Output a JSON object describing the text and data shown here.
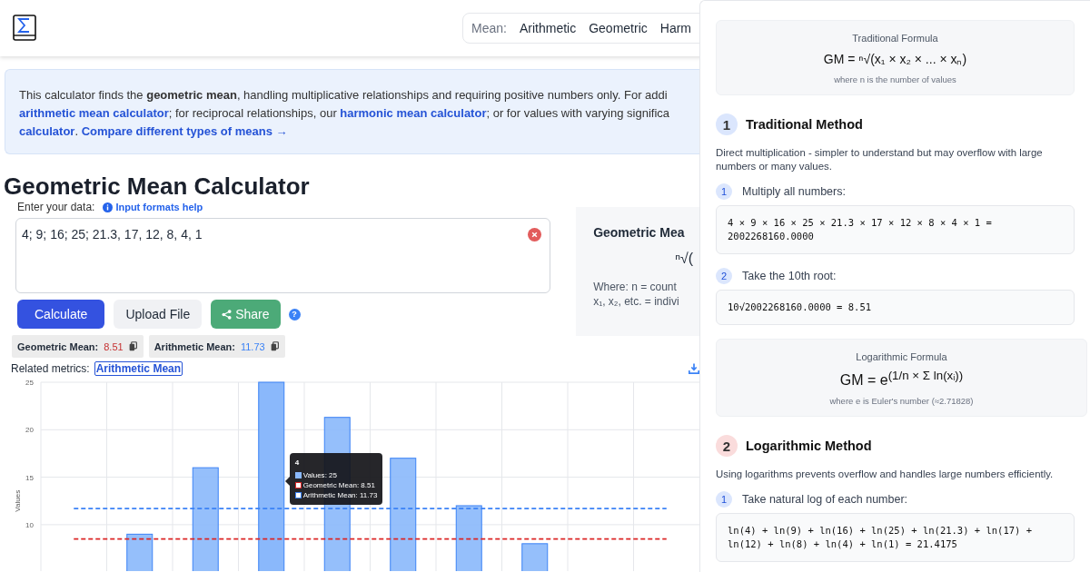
{
  "header": {
    "nav_label": "Mean:",
    "nav_items": [
      "Arithmetic",
      "Geometric",
      "Harm"
    ]
  },
  "intro": [
    {
      "kind": "text",
      "text": "This calculator finds the "
    },
    {
      "kind": "bold",
      "text": "geometric mean"
    },
    {
      "kind": "text",
      "text": ", handling multiplicative relationships and requiring positive numbers only. For addi"
    },
    {
      "kind": "break"
    },
    {
      "kind": "link",
      "text": "arithmetic mean calculator"
    },
    {
      "kind": "text",
      "text": "; for reciprocal relationships, our "
    },
    {
      "kind": "link",
      "text": "harmonic mean calculator"
    },
    {
      "kind": "text",
      "text": "; or for values with varying significa"
    },
    {
      "kind": "break"
    },
    {
      "kind": "link",
      "text": "calculator"
    },
    {
      "kind": "text",
      "text": ". "
    },
    {
      "kind": "link",
      "text": "Compare different types of means →"
    }
  ],
  "title": "Geometric Mean Calculator",
  "input": {
    "label": "Enter your data:",
    "help_link": "Input formats help",
    "value": "4; 9; 16; 25; 21.3, 17, 12, 8, 4, 1"
  },
  "buttons": [
    {
      "label": "Calculate",
      "kind": "primary"
    },
    {
      "label": "Upload File",
      "kind": "secondary"
    },
    {
      "label": "Share",
      "kind": "share"
    }
  ],
  "help_icon": "?",
  "results": [
    {
      "label": "Geometric Mean:",
      "value": "8.51",
      "color": "#c53030"
    },
    {
      "label": "Arithmetic Mean:",
      "value": "11.73",
      "color": "#3b82f6"
    }
  ],
  "related": {
    "label": "Related metrics:",
    "link": "Arithmetic Mean"
  },
  "chart": {
    "chart_data": {
      "type": "bar",
      "ylabel": "Values",
      "ylim": [
        5,
        25
      ],
      "yticks": [
        10,
        15,
        20,
        25
      ],
      "grid": true,
      "legend": "center",
      "series": [
        {
          "name": "Values",
          "type": "bar",
          "color": "#8ab8fb",
          "values": [
            null,
            9,
            16,
            25,
            21.3,
            17,
            12,
            8,
            null,
            null
          ]
        },
        {
          "name": "Geometric Mean",
          "type": "line",
          "line_style": "dashed",
          "color": "#dc2626",
          "values": [
            8.5,
            8.5,
            8.5,
            8.5,
            8.5,
            8.5,
            8.5,
            8.5,
            8.5,
            8.5
          ]
        },
        {
          "name": "Arithmetic Mean",
          "type": "line",
          "line_style": "dashed",
          "color": "#3b82f6",
          "values": [
            11.7,
            11.7,
            11.7,
            11.7,
            11.7,
            11.7,
            11.7,
            11.7,
            11.7,
            11.7
          ]
        }
      ]
    },
    "tooltip": {
      "title": "4",
      "values": [
        ": 25",
        ": 8.51",
        ": 11.73"
      ]
    }
  },
  "formula_card": {
    "title": "Geometric Mea",
    "formula": "ⁿ√(",
    "note_lines": [
      "Where: n = count",
      "x₁, x₂, etc. = indivi"
    ]
  },
  "panel": [
    {
      "kind": "formula",
      "title": "Traditional Formula",
      "formula": "GM = ⁿ√(x₁ × x₂ × ... × xₙ)",
      "note": "where n is the number of values"
    },
    {
      "kind": "method",
      "number": "1",
      "color": "#dbe6fd",
      "title": "Traditional Method",
      "description": "Direct multiplication - simpler to understand but may overflow with large numbers or many values.",
      "steps": [
        {
          "number": "1",
          "title": "Multiply all numbers:",
          "code": "4 × 9 × 16 × 25 × 21.3 × 17 × 12 × 8 × 4 × 1 = 2002268160.0000"
        },
        {
          "number": "2",
          "title": "Take the 10th root:",
          "code": "10√2002268160.0000 = 8.51"
        }
      ]
    },
    {
      "kind": "formula",
      "title": "Logarithmic Formula",
      "formula": "GM = e$^{(1/n × Σ ln(xᵢ))}$",
      "note": "where e is Euler's number (≈2.71828)"
    },
    {
      "kind": "method",
      "number": "2",
      "color": "#fadcdc",
      "title": "Logarithmic Method",
      "description": "Using logarithms prevents overflow and handles large numbers efficiently.",
      "steps": [
        {
          "number": "1",
          "title": "Take natural log of each number:",
          "code": "ln(4) + ln(9) + ln(16) + ln(25) + ln(21.3) + ln(17) + ln(12) + ln(8) + ln(4) + ln(1) = 21.4175"
        }
      ]
    }
  ]
}
